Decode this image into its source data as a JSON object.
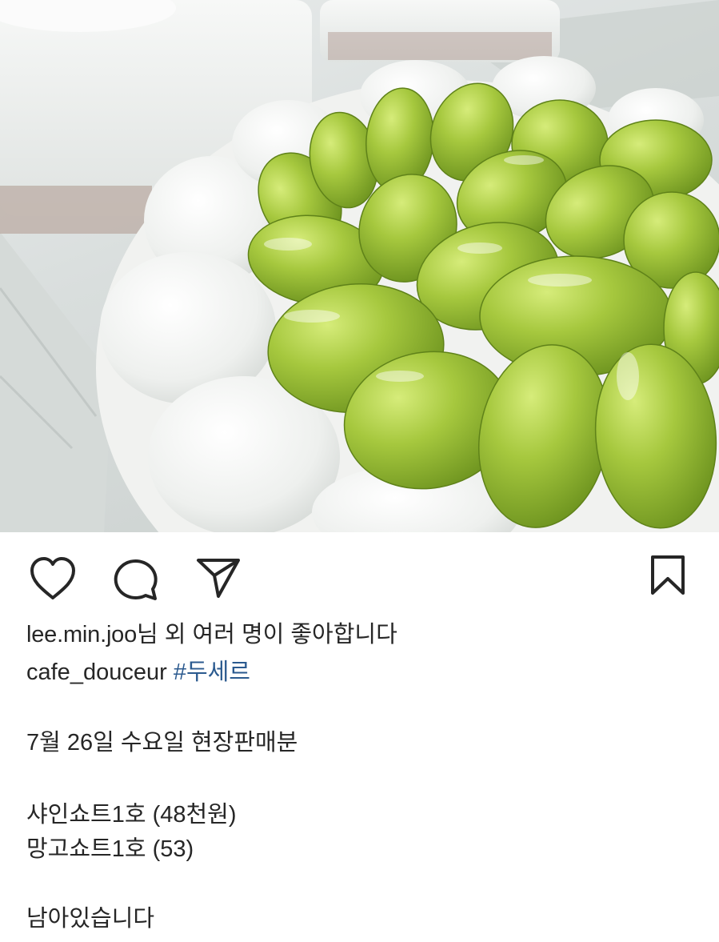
{
  "photo": {
    "subject": "shine-muscat-cake-photo",
    "accent_green": "#9cc23a",
    "cream": "#f3f4f2"
  },
  "actions": {
    "like_icon": "heart-icon",
    "comment_icon": "speech-bubble-icon",
    "share_icon": "paper-plane-icon",
    "save_icon": "bookmark-icon"
  },
  "likes": {
    "user": "lee.min.joo",
    "suffix": "님 외 여러 명이 좋아합니다"
  },
  "caption": {
    "author": "cafe_douceur",
    "hashtag": "#두세르",
    "lines": [
      "7월 26일 수요일 현장판매분",
      "샤인쇼트1호 (48천원)",
      "망고쇼트1호 (53)",
      "남아있습니다"
    ]
  },
  "colors": {
    "text": "#262626",
    "hashtag": "#2b5a8f"
  }
}
